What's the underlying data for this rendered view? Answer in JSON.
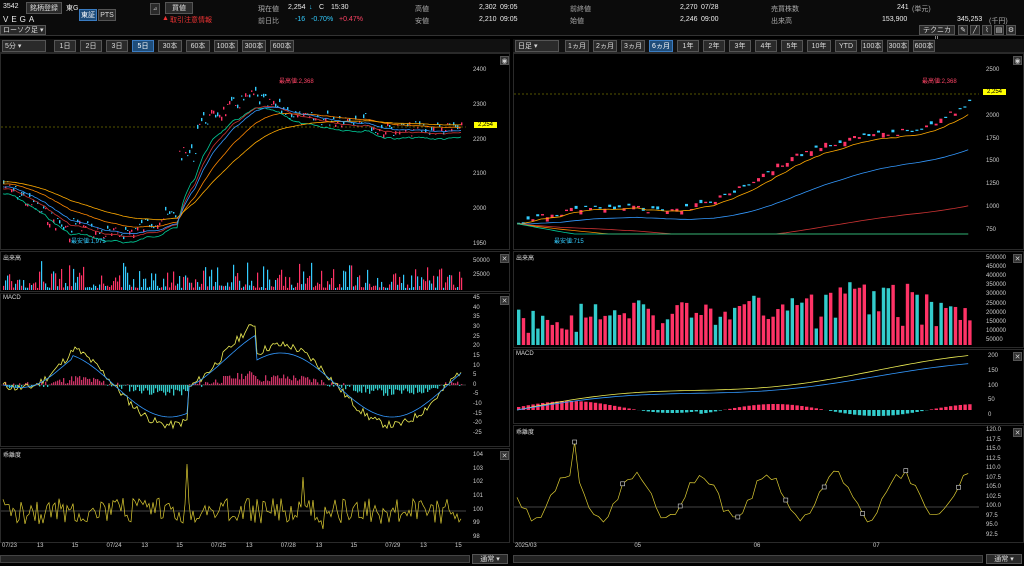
{
  "header": {
    "code": "3542",
    "name_btn": "銘柄登録",
    "exchange": "東G",
    "name": "VEGA",
    "tab_tse": "東証",
    "tab_pts": "PTS",
    "buy_btn": "買値",
    "warning": "取引注意情報",
    "now_lbl": "現在値",
    "now": "2,254",
    "now_arrow": "↓",
    "c": "C",
    "time": "15:30",
    "prev_lbl": "前日比",
    "diff": "-16",
    "pct": "-0.70%",
    "pct2": "+0.47%",
    "high_lbl": "高値",
    "high": "2,302",
    "high_t": "09:05",
    "low_lbl": "安値",
    "low": "2,210",
    "low_t": "09:05",
    "close_prev_lbl": "前終値",
    "close_prev": "2,270",
    "close_prev_d": "07/28",
    "open_lbl": "始値",
    "open": "2,246",
    "open_t": "09:00",
    "shares_lbl": "売買株数",
    "shares": "241",
    "shares_u": "(単元)",
    "vol_lbl": "出来高",
    "vol": "153,900",
    "amount": "345,253",
    "amount_u": "(千円)",
    "tech_btn": "テクニカル",
    "candle_sel": "ローソク足"
  },
  "left": {
    "interval": "5分",
    "ranges": [
      "1日",
      "2日",
      "3日",
      "5日",
      "30本",
      "60本",
      "100本",
      "300本",
      "600本"
    ],
    "active": 3,
    "price_ticks": [
      "2400",
      "2300",
      "2200",
      "2100",
      "2000",
      "1950"
    ],
    "sub_ticks": [
      "2350",
      "2250",
      "2150",
      "2050"
    ],
    "cur": "2,254",
    "max_lbl": "最高値:2,368",
    "min_lbl": "最安値:1,975",
    "vol_title": "出来高",
    "vol_ticks": [
      "50000",
      "25000"
    ],
    "macd_title": "MACD",
    "macd_ticks": [
      "45",
      "40",
      "35",
      "30",
      "25",
      "20",
      "15",
      "10",
      "5",
      "0",
      "-5",
      "-10",
      "-15",
      "-20",
      "-25"
    ],
    "dev_title": "乖離度",
    "dev_ticks": [
      "104",
      "103",
      "102",
      "101",
      "100",
      "99",
      "98"
    ],
    "dates": [
      "07/23",
      "13",
      "15",
      "07/24",
      "13",
      "15",
      "07/25",
      "13",
      "07/28",
      "13",
      "15",
      "07/29",
      "13",
      "15"
    ]
  },
  "right": {
    "interval": "日足",
    "ranges": [
      "1ヵ月",
      "2ヵ月",
      "3ヵ月",
      "6ヵ月",
      "1年",
      "2年",
      "3年",
      "4年",
      "5年",
      "10年",
      "YTD",
      "100本",
      "300本",
      "600本"
    ],
    "active": 3,
    "price_ticks": [
      "2500",
      "2250",
      "2000",
      "1750",
      "1500",
      "1250",
      "1000",
      "750"
    ],
    "cur": "2,254",
    "max_lbl": "最高値:2,368",
    "min_lbl": "最安値:715",
    "vol_title": "出来高",
    "vol_ticks": [
      "500000",
      "450000",
      "400000",
      "350000",
      "300000",
      "250000",
      "200000",
      "150000",
      "100000",
      "50000"
    ],
    "macd_title": "MACD",
    "macd_ticks": [
      "200",
      "150",
      "100",
      "50",
      "0"
    ],
    "dev_title": "乖離度",
    "dev_ticks": [
      "120.0",
      "117.5",
      "115.0",
      "112.5",
      "110.0",
      "107.5",
      "105.0",
      "102.5",
      "100.0",
      "97.5",
      "95.0",
      "92.5"
    ],
    "dates": [
      "2025/03",
      "05",
      "06",
      "07"
    ]
  },
  "footer": {
    "mode": "通常"
  }
}
